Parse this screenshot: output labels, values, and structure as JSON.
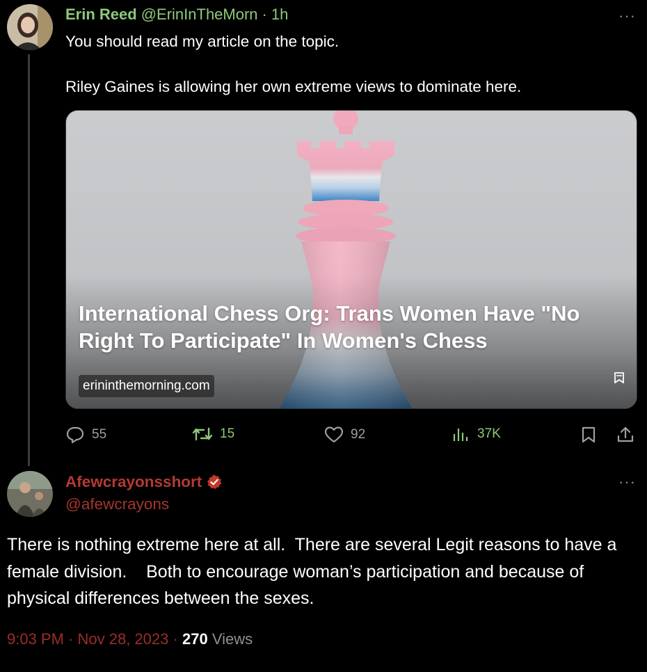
{
  "tweet1": {
    "author_name": "Erin Reed",
    "handle": "@ErinInTheMorn",
    "separator": "·",
    "time": "1h",
    "more_label": "···",
    "text_line1": "You should read my article on the topic.",
    "text_line2": "Riley Gaines is allowing her own extreme views to dominate here.",
    "card": {
      "title": "International Chess Org: Trans Women Have \"No Right To Participate\" In Women's Chess",
      "domain": "erininthemorning.com"
    },
    "actions": {
      "replies": "55",
      "reposts": "15",
      "likes": "92",
      "views": "37K"
    }
  },
  "tweet2": {
    "author_name": "Afewcrayonsshort",
    "handle": "@afewcrayons",
    "more_label": "···",
    "text": "There is nothing extreme here at all.  There are several Legit reasons to have a female division.    Both to encourage woman’s participation and because of physical differences between the sexes.",
    "time": "9:03 PM",
    "separator": "·",
    "date": "Nov 28, 2023",
    "views_count": "270",
    "views_label": "Views"
  },
  "colors": {
    "background": "#000000",
    "name_green": "#8ec97a",
    "name_red": "#b63a32",
    "muted": "#8b9196"
  },
  "icons": [
    "reply-icon",
    "repost-icon",
    "like-icon",
    "views-icon",
    "bookmark-icon",
    "share-icon",
    "verified-badge-icon",
    "more-icon"
  ]
}
